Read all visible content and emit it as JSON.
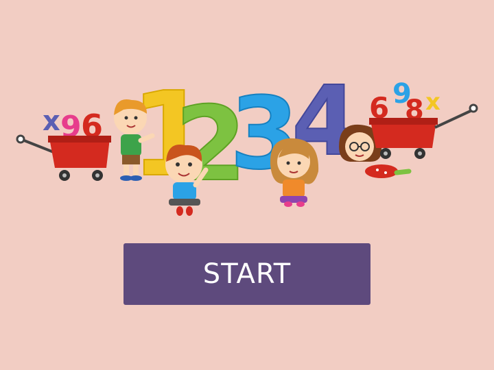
{
  "start_button": {
    "label": "START"
  },
  "colors": {
    "background": "#f2cdc3",
    "button": "#5e4a7d",
    "digit_one": "#f3c623",
    "digit_two": "#7dc241",
    "digit_three": "#2ba2e6",
    "digit_four": "#5b5fb3",
    "wagon": "#d42a1f"
  },
  "illustration": {
    "digits": [
      "1",
      "2",
      "3",
      "4"
    ],
    "left_wagon_numbers": [
      "x",
      "9",
      "6"
    ],
    "right_wagon_numbers": [
      "9",
      "6",
      "8",
      "x"
    ]
  }
}
